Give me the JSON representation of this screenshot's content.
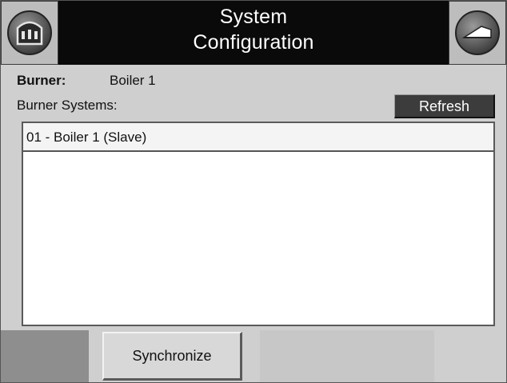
{
  "header": {
    "title_line1": "System",
    "title_line2": "Configuration",
    "left_icon": "home-icon",
    "right_icon": "back-icon"
  },
  "burner": {
    "label": "Burner:",
    "value": "Boiler 1"
  },
  "systems": {
    "label": "Burner Systems:",
    "refresh_label": "Refresh",
    "items": [
      {
        "label": "01 - Boiler 1 (Slave)"
      }
    ]
  },
  "footer": {
    "synchronize_label": "Synchronize"
  },
  "colors": {
    "header_bg": "#0a0a0a",
    "panel_bg": "#cfcfcf",
    "button_dark": "#3c3c3c"
  }
}
